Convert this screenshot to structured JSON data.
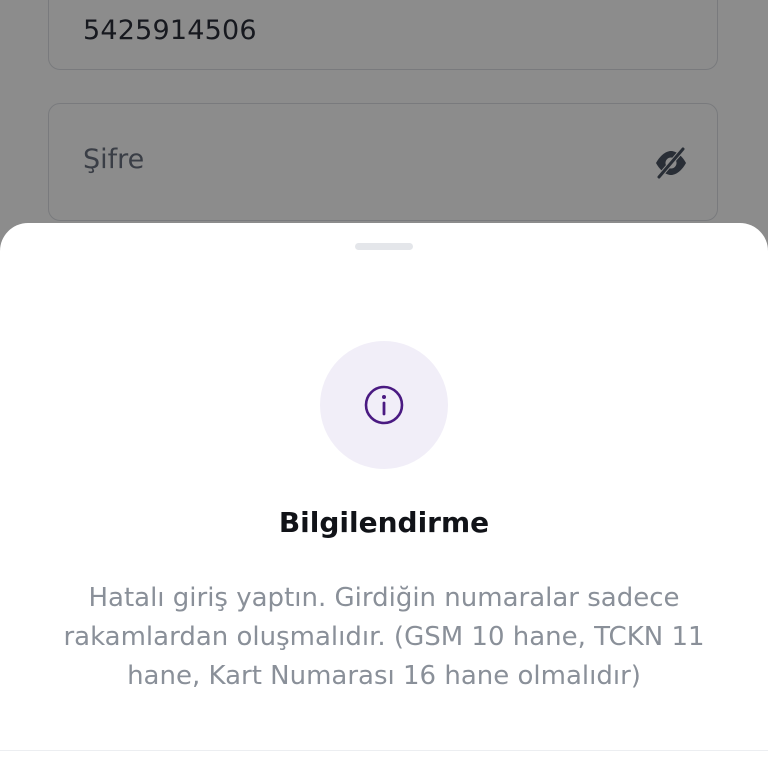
{
  "form": {
    "phone_value": "5425914506",
    "password_placeholder": "Şifre",
    "password_toggle_icon": "eye-off-icon"
  },
  "dialog": {
    "icon": "info-icon",
    "accent_color": "#4a1a82",
    "title": "Bilgilendirme",
    "message": "Hatalı giriş yaptın. Girdiğin numaralar sadece rakamlardan oluşmalıdır. (GSM  10 hane, TCKN 11 hane, Kart Numarası 16 hane olmalıdır)"
  }
}
